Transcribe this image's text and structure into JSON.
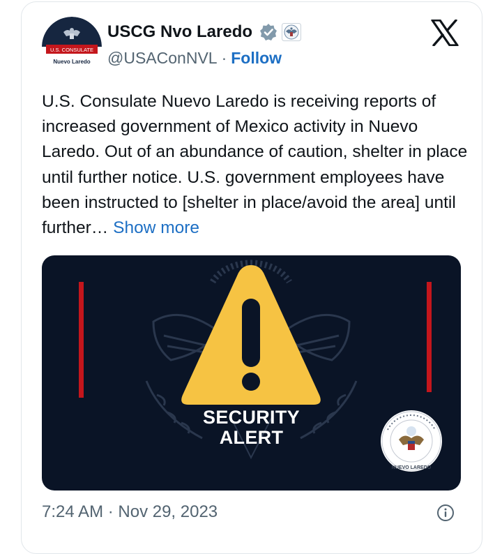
{
  "tweet": {
    "author": {
      "display_name": "USCG Nvo Laredo",
      "handle": "@USAConNVL",
      "follow_label": "Follow",
      "avatar": {
        "banner_text": "U.S. CONSULATE",
        "subtitle": "Nuevo Laredo"
      },
      "badges": [
        "verified-badge-icon",
        "us-government-seal-icon"
      ]
    },
    "separator": "·",
    "text": "U.S. Consulate Nuevo Laredo is receiving reports of increased government of Mexico activity in Nuevo Laredo. Out of an abundance of caution, shelter in place until further notice. U.S. government employees have been instructed to [shelter in place/avoid the area] until further…",
    "show_more_label": "Show more",
    "media": {
      "alert_line1": "SECURITY",
      "alert_line2": "ALERT",
      "seal_text": "NUEVO LAREDO"
    },
    "timestamp": "7:24 AM · Nov 29, 2023"
  },
  "colors": {
    "link_blue": "#1d6fc4",
    "media_bg": "#0a1426",
    "warning_yellow": "#f6c343",
    "alert_red": "#c4161c"
  }
}
